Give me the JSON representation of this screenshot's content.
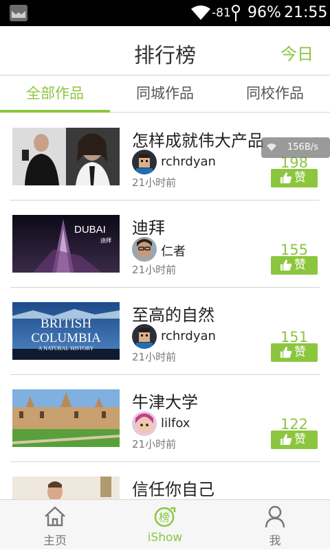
{
  "status_bar": {
    "signal": "-81",
    "battery": "96%",
    "time": "21:55"
  },
  "header": {
    "title": "排行榜",
    "right_action": "今日"
  },
  "tabs": [
    {
      "label": "全部作品",
      "active": true
    },
    {
      "label": "同城作品",
      "active": false
    },
    {
      "label": "同校作品",
      "active": false
    }
  ],
  "items": [
    {
      "title": "怎样成就伟大产品",
      "user": "rchrdyan",
      "time": "21小时前",
      "likes": "198",
      "like_label": "赞",
      "thumb": "jobs-photo"
    },
    {
      "title": "迪拜",
      "user": "仁者",
      "time": "21小时前",
      "likes": "155",
      "like_label": "赞",
      "thumb": "dubai-photo",
      "thumb_text": "DUBAI",
      "thumb_text_small": "迪拜"
    },
    {
      "title": "至高的自然",
      "user": "rchrdyan",
      "time": "21小时前",
      "likes": "151",
      "like_label": "赞",
      "thumb": "british-columbia-photo",
      "thumb_line1": "BRITISH",
      "thumb_line2": "COLUMBIA",
      "thumb_line3": "A NATURAL HISTORY"
    },
    {
      "title": "牛津大学",
      "user": "lilfox",
      "time": "21小时前",
      "likes": "122",
      "like_label": "赞",
      "thumb": "oxford-photo"
    },
    {
      "title": "信任你自己",
      "thumb": "person-photo"
    }
  ],
  "net_speed": "156B/s",
  "bottom_nav": [
    {
      "label": "主页",
      "icon": "home-icon",
      "active": false
    },
    {
      "label": "iShow",
      "icon": "ranking-icon",
      "icon_char": "榜",
      "active": true
    },
    {
      "label": "我",
      "icon": "person-icon",
      "active": false
    }
  ],
  "colors": {
    "accent": "#8cc63f",
    "status_bar": "#000000"
  }
}
